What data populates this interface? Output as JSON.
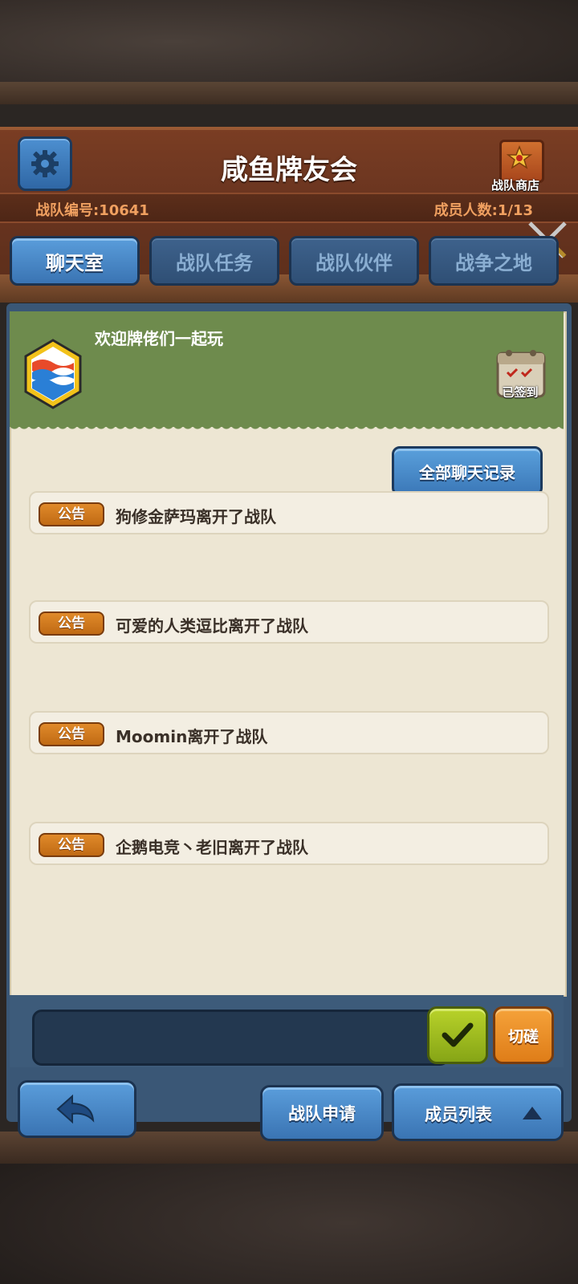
{
  "header": {
    "title": "咸鱼牌友会",
    "team_id": "战队编号:10641",
    "member_count": "成员人数:1/13",
    "shop_label": "战队商店"
  },
  "tabs": [
    {
      "label": "聊天室",
      "active": true
    },
    {
      "label": "战队任务",
      "active": false
    },
    {
      "label": "战队伙伴",
      "active": false
    },
    {
      "label": "战争之地",
      "active": false
    }
  ],
  "banner": {
    "welcome": "欢迎牌佬们一起玩",
    "checkin_label": "已签到"
  },
  "chat": {
    "history_button": "全部聊天记录",
    "messages": [
      {
        "badge": "公告",
        "text": "狗修金萨玛离开了战队"
      },
      {
        "badge": "公告",
        "text": "可爱的人类逗比离开了战队"
      },
      {
        "badge": "公告",
        "text": "Moomin离开了战队"
      },
      {
        "badge": "公告",
        "text": "企鹅电竞丶老旧离开了战队"
      }
    ],
    "input_value": "",
    "switch_label": "切磋"
  },
  "footer": {
    "apply_label": "战队申请",
    "members_label": "成员列表"
  },
  "colors": {
    "accent_blue": "#3a74b3",
    "badge_orange": "#e08a2a",
    "banner_green": "#6e8b4d",
    "send_green": "#9cbc1e"
  },
  "icons": {
    "settings": "gear-icon",
    "shop": "shop-icon",
    "swords": "crossed-swords-icon",
    "checkin": "calendar-icon",
    "send": "checkmark-icon",
    "back": "back-arrow-icon",
    "expand": "triangle-up-icon"
  }
}
